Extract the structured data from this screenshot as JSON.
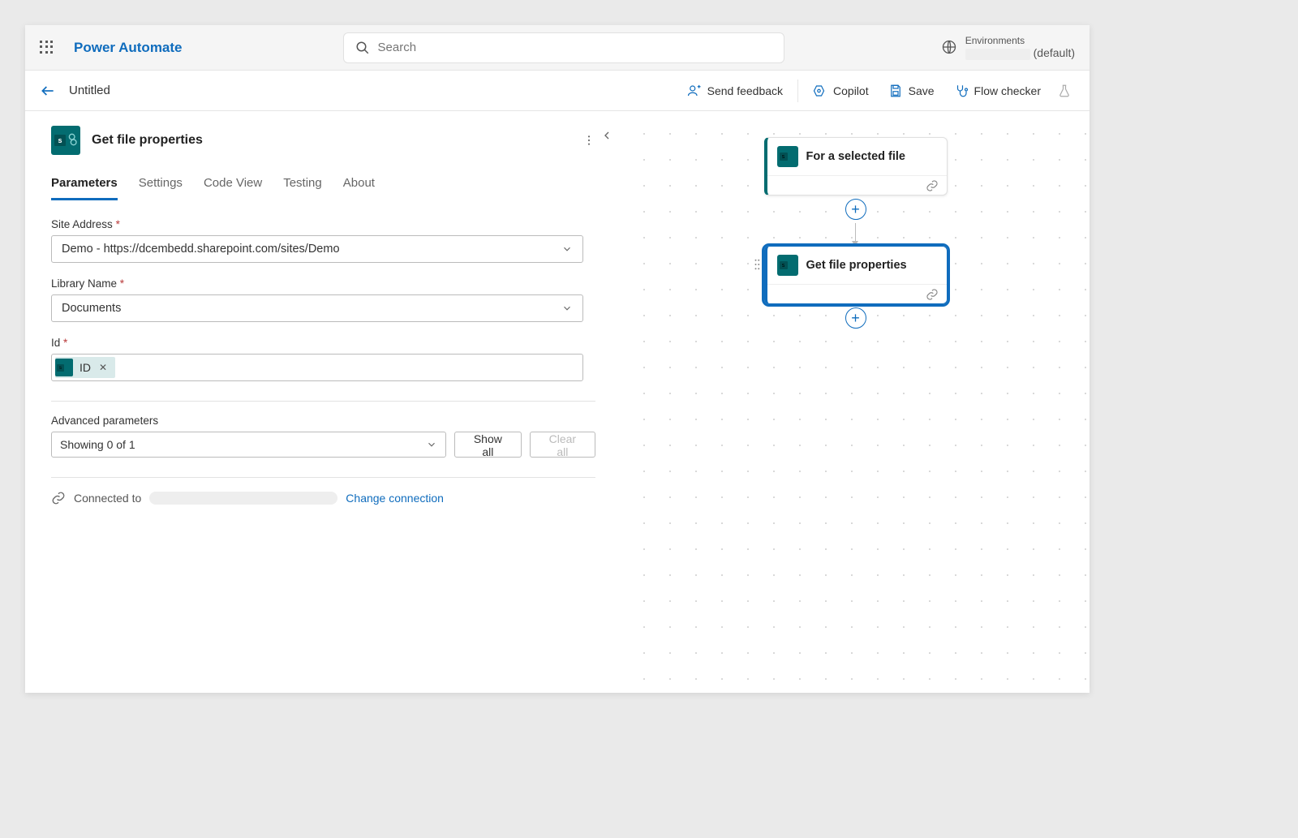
{
  "app": {
    "title": "Power Automate"
  },
  "search": {
    "placeholder": "Search"
  },
  "env": {
    "label": "Environments",
    "name_suffix": "(default)"
  },
  "cmdbar": {
    "flow_title": "Untitled",
    "feedback": "Send feedback",
    "copilot": "Copilot",
    "save": "Save",
    "checker": "Flow checker"
  },
  "panel": {
    "title": "Get file properties",
    "tabs": {
      "parameters": "Parameters",
      "settings": "Settings",
      "code_view": "Code View",
      "testing": "Testing",
      "about": "About"
    },
    "form": {
      "site_label": "Site Address",
      "site_value": "Demo - https://dcembedd.sharepoint.com/sites/Demo",
      "library_label": "Library Name",
      "library_value": "Documents",
      "id_label": "Id",
      "id_token": "ID"
    },
    "advanced": {
      "label": "Advanced parameters",
      "showing": "Showing 0 of 1",
      "show_all": "Show all",
      "clear_all": "Clear all"
    },
    "connection": {
      "connected_to": "Connected to",
      "change": "Change connection"
    }
  },
  "canvas": {
    "node1": "For a selected file",
    "node2": "Get file properties"
  }
}
